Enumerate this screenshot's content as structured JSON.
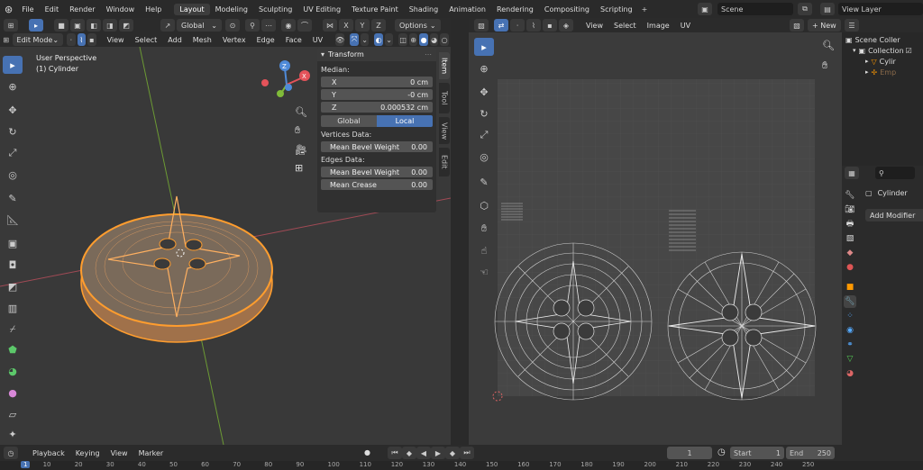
{
  "top_menu": [
    "File",
    "Edit",
    "Render",
    "Window",
    "Help"
  ],
  "workspace_tabs": [
    {
      "label": "Layout",
      "active": true
    },
    {
      "label": "Modeling",
      "active": false
    },
    {
      "label": "Sculpting",
      "active": false
    },
    {
      "label": "UV Editing",
      "active": false
    },
    {
      "label": "Texture Paint",
      "active": false
    },
    {
      "label": "Shading",
      "active": false
    },
    {
      "label": "Animation",
      "active": false
    },
    {
      "label": "Rendering",
      "active": false
    },
    {
      "label": "Compositing",
      "active": false
    },
    {
      "label": "Scripting",
      "active": false
    }
  ],
  "add_workspace": "+",
  "scene_name": "Scene",
  "view_layer": "View Layer",
  "viewport": {
    "mode": "Edit Mode",
    "menus": [
      "View",
      "Select",
      "Add",
      "Mesh",
      "Vertex",
      "Edge",
      "Face",
      "UV"
    ],
    "transform_orientation": "Global",
    "options_label": "Options",
    "axis_toggles": [
      "X",
      "Y",
      "Z"
    ],
    "overlay_line1": "User Perspective",
    "overlay_line2": "(1) Cylinder",
    "gizmo": {
      "x": "X",
      "y": "Y",
      "z": "Z"
    }
  },
  "npanel": {
    "header": "Transform",
    "median_label": "Median:",
    "fields": [
      {
        "label": "X",
        "value": "0 cm"
      },
      {
        "label": "Y",
        "value": "-0 cm"
      },
      {
        "label": "Z",
        "value": "0.000532 cm"
      }
    ],
    "space_buttons": [
      {
        "label": "Global",
        "active": false
      },
      {
        "label": "Local",
        "active": true
      }
    ],
    "vertices_label": "Vertices Data:",
    "vertex_fields": [
      {
        "label": "Mean Bevel Weight",
        "value": "0.00"
      }
    ],
    "edges_label": "Edges Data:",
    "edge_fields": [
      {
        "label": "Mean Bevel Weight",
        "value": "0.00"
      },
      {
        "label": "Mean Crease",
        "value": "0.00"
      }
    ],
    "tabs": [
      {
        "label": "Item",
        "active": true
      },
      {
        "label": "Tool",
        "active": false
      },
      {
        "label": "View",
        "active": false
      },
      {
        "label": "Edit",
        "active": false
      }
    ]
  },
  "uv_editor": {
    "menus": [
      "View",
      "Select",
      "Image",
      "UV"
    ],
    "new_label": "+ New"
  },
  "outliner": {
    "rows": [
      {
        "label": "Scene Coller",
        "indent": 0
      },
      {
        "label": "Collection",
        "indent": 1
      },
      {
        "label": "Cylir",
        "indent": 2
      },
      {
        "label": "Emp",
        "indent": 2
      }
    ]
  },
  "properties": {
    "object_name": "Cylinder",
    "add_modifier": "Add Modifier"
  },
  "timeline": {
    "menus": [
      "Playback",
      "Keying",
      "View",
      "Marker"
    ],
    "current_frame": "1",
    "start_label": "Start",
    "start_value": "1",
    "end_label": "End",
    "end_value": "250",
    "ruler": [
      "1",
      "10",
      "20",
      "30",
      "40",
      "50",
      "60",
      "70",
      "80",
      "90",
      "100",
      "110",
      "120",
      "130",
      "140",
      "150",
      "160",
      "170",
      "180",
      "190",
      "200",
      "210",
      "220",
      "230",
      "240",
      "250"
    ]
  },
  "colors": {
    "accent": "#4772b3",
    "selection": "#ff9d2e",
    "bg_viewport": "#393939",
    "bg_uv": "#474747"
  }
}
